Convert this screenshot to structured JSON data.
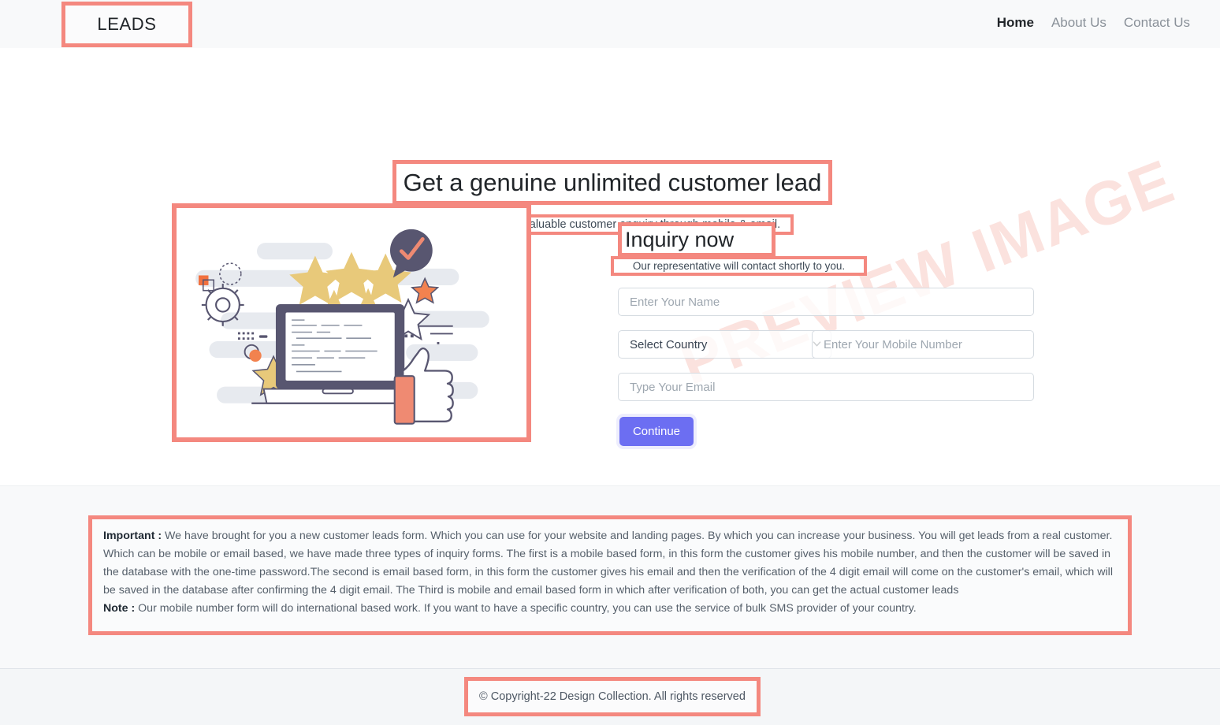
{
  "navbar": {
    "brand": "LEADS",
    "links": [
      {
        "label": "Home",
        "active": true
      },
      {
        "label": "About Us",
        "active": false
      },
      {
        "label": "Contact Us",
        "active": false
      }
    ]
  },
  "watermark": {
    "text": "PREVIEW IMAGE"
  },
  "hero": {
    "title": "Get a genuine unlimited customer lead",
    "subtitle": "You can receive valuable customer enquiry through mobile & email."
  },
  "illustration": {
    "name": "customer-reviews-laptop-illustration",
    "colors": {
      "slate": "#585670",
      "star_gold": "#e8c97a",
      "salmon": "#ef8a72",
      "orange": "#f2713f",
      "bg_shape": "#e7eaef"
    }
  },
  "form": {
    "title": "Inquiry now",
    "subtitle": "Our representative will contact shortly to you.",
    "fields": {
      "name_placeholder": "Enter Your Name",
      "country_value": "Select Country",
      "mobile_placeholder": "Enter Your Mobile Number",
      "email_placeholder": "Type Your Email"
    },
    "submit_label": "Continue",
    "accent_color": "#6c6ef2"
  },
  "info": {
    "important_label": "Important :",
    "important_text": " We have brought for you a new customer leads form. Which you can use for your website and landing pages. By which you can increase your business. You will get leads from a real customer. Which can be mobile or email based, we have made three types of inquiry forms. The first is a mobile based form, in this form the customer gives his mobile number, and then the customer will be saved in the database with the one-time password.The second is email based form, in this form the customer gives his email and then the verification of the 4 digit email will come on the customer's email, which will be saved in the database after confirming the 4 digit email. The Third is mobile and email based form in which after verification of both, you can get the actual customer leads",
    "note_label": "Note :",
    "note_text": " Our mobile number form will do international based work. If you want to have a specific country, you can use the service of bulk SMS provider of your country."
  },
  "footer": {
    "copyright": "© Copyright-22 Design Collection. All rights reserved"
  },
  "highlight_color": "#f4887f"
}
